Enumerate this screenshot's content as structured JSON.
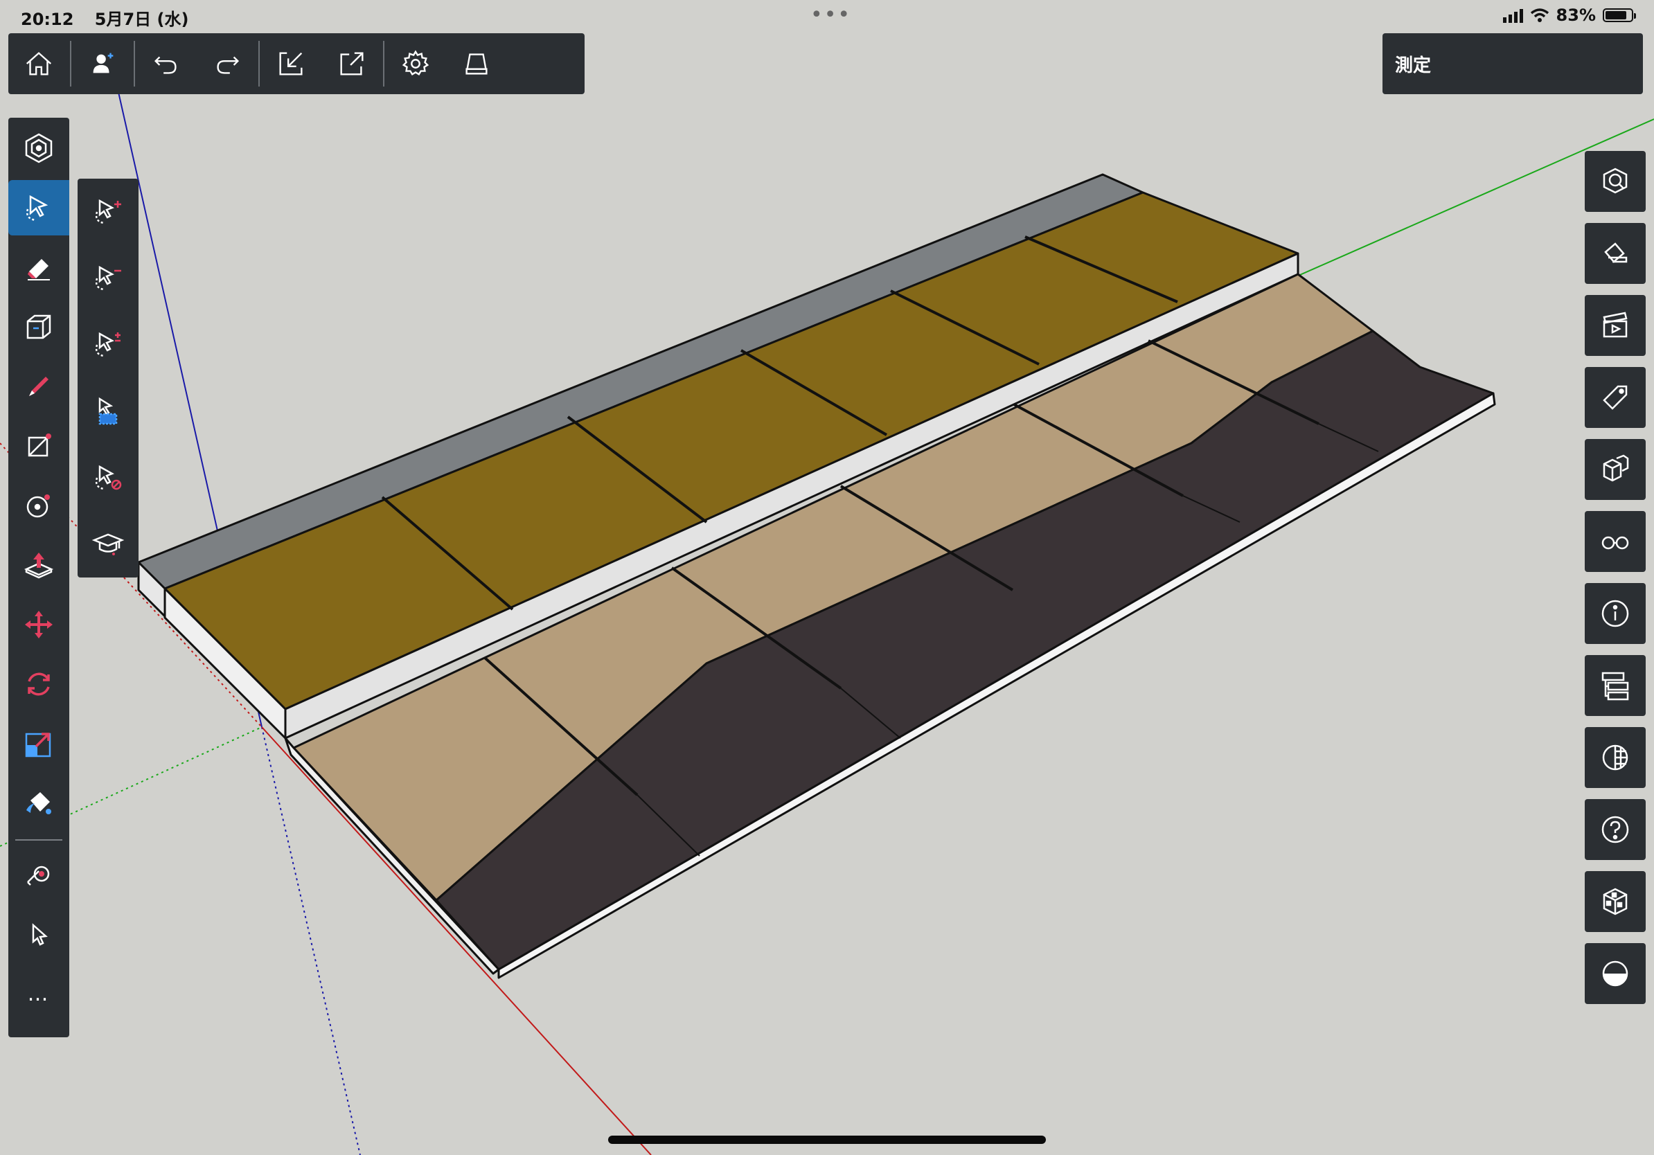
{
  "status_bar": {
    "time": "20:12",
    "date": "5月7日 (水)",
    "battery": "83%",
    "battery_level": 0.83
  },
  "measure_panel": {
    "label": "測定"
  },
  "top_toolbar": [
    "home-icon",
    "add-user-icon",
    "undo-icon",
    "redo-icon",
    "import-icon",
    "export-icon",
    "settings-icon",
    "storage-icon"
  ],
  "left_toolbar": [
    "search-cube-icon",
    "select-icon",
    "eraser-icon",
    "box-icon",
    "pencil-icon",
    "rectangle-icon",
    "circle-icon",
    "push-pull-icon",
    "move-icon",
    "rotate-icon",
    "scale-icon",
    "paint-bucket-icon",
    "tape-measure-icon",
    "arrow-cursor-icon"
  ],
  "left_more": "…",
  "select_flyout": [
    "select-add-icon",
    "select-remove-icon",
    "select-toggle-icon",
    "select-group-icon",
    "select-none-icon",
    "tutorial-icon"
  ],
  "right_toolbar": [
    "3d-warehouse-icon",
    "materials-icon",
    "scenes-icon",
    "tags-icon",
    "components-icon",
    "view-glasses-icon",
    "info-icon",
    "outliner-icon",
    "styles-icon",
    "help-icon",
    "object-info-icon",
    "shadows-icon"
  ],
  "colors": {
    "toolbar": "#2b2f33",
    "active": "#1f6aa8",
    "olive": "#846818",
    "tan": "#b59d7b",
    "dark": "#3a3336",
    "gray": "#7c8083",
    "canvas": "#d1d1cd"
  }
}
